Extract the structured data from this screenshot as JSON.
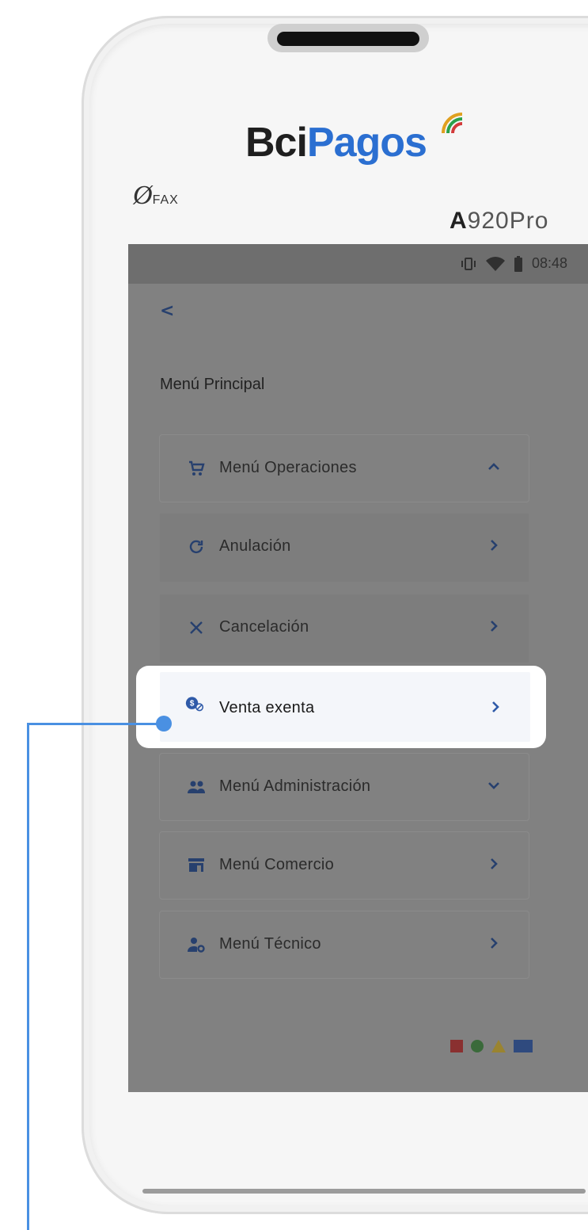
{
  "device": {
    "brand_first": "Bci",
    "brand_second": "Pagos",
    "maker": "FAX",
    "model_prefix": "A",
    "model_rest": "920Pro"
  },
  "status_bar": {
    "time": "08:48",
    "icons": [
      "vibrate-icon",
      "wifi-icon",
      "battery-icon"
    ]
  },
  "nav": {
    "back_label": "<",
    "title": "Menú Principal"
  },
  "menu": {
    "operations": {
      "label": "Menú Operaciones",
      "icon": "cart-icon",
      "expanded": true
    },
    "sub_items": [
      {
        "label": "Anulación",
        "icon": "refresh-icon"
      },
      {
        "label": "Cancelación",
        "icon": "close-icon"
      },
      {
        "label": "Venta exenta",
        "icon": "dollar-exempt-icon",
        "highlighted": true
      }
    ],
    "administration": {
      "label": "Menú Administración",
      "icon": "users-icon",
      "expanded": false
    },
    "commerce": {
      "label": "Menú Comercio",
      "icon": "store-icon"
    },
    "technical": {
      "label": "Menú Técnico",
      "icon": "user-gear-icon"
    }
  },
  "footer_marks": {
    "colors": [
      "#b03a3a",
      "#3c7a3c",
      "#c9a93a",
      "#3a5fa8"
    ]
  },
  "colors": {
    "accent": "#4a90e2",
    "screen_overlay": "#818181",
    "icon_blue": "#2f5aa8"
  }
}
